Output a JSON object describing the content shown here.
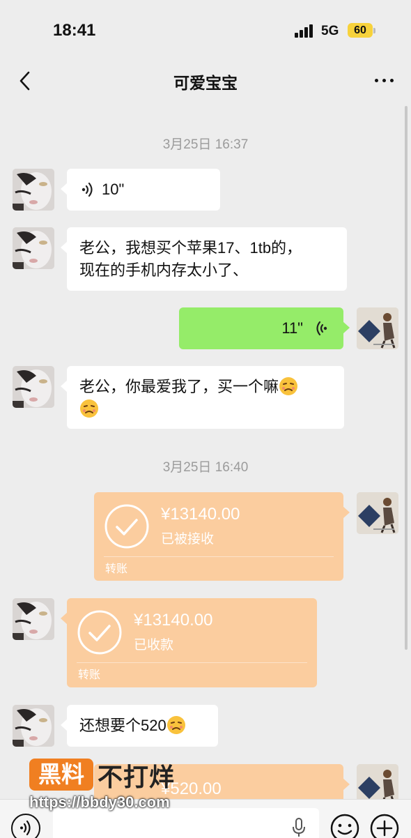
{
  "status_bar": {
    "time": "18:41",
    "network": "5G",
    "battery": "60"
  },
  "header": {
    "title": "可爱宝宝"
  },
  "messages": {
    "ts1": "3月25日 16:37",
    "voice1": "10\"",
    "text1_line1": "老公，我想买个苹果17、1tb的，",
    "text1_line2": "现在的手机内存太小了、",
    "voice2": "11\"",
    "text2_line1": "老公，你最爱我了，买一个嘛",
    "ts2": "3月25日 16:40",
    "transfer1": {
      "amount": "¥13140.00",
      "status": "已被接收",
      "label": "转账"
    },
    "transfer2": {
      "amount": "¥13140.00",
      "status": "已收款",
      "label": "转账"
    },
    "text3": "还想要个520",
    "transfer3": {
      "amount": "¥520.00"
    }
  },
  "watermark": {
    "brand": "黑料",
    "text": "不打烊",
    "url": "https://bbdy30.com"
  },
  "colors": {
    "chat_bg": "#ededed",
    "bubble_in": "#ffffff",
    "bubble_out": "#95ec69",
    "transfer": "#fbcd9f",
    "battery": "#f7d23b",
    "watermark_orange": "#f07f21"
  },
  "icons": {
    "back": "chevron-left-icon",
    "more": "more-dots-icon",
    "voice_in": "voice-wave-icon",
    "voice_out": "voice-wave-icon",
    "transfer": "check-circle-icon",
    "emoji": "distressed-face-icon",
    "input_voice": "voice-mode-icon",
    "mic": "microphone-icon",
    "emoji_button": "smiley-icon",
    "plus": "plus-circle-icon"
  }
}
